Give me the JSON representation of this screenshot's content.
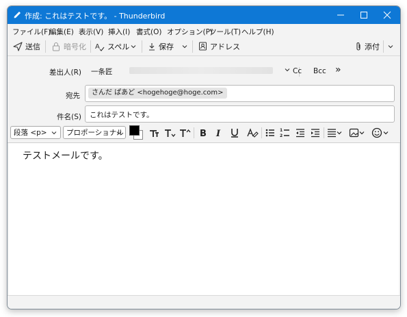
{
  "window": {
    "title": "作成: これはテストです。 - Thunderbird",
    "controls": [
      "minimize",
      "maximize",
      "close"
    ]
  },
  "menu": [
    "ファイル(F)",
    "編集(E)",
    "表示(V)",
    "挿入(I)",
    "書式(O)",
    "オプション(P)",
    "ツール(T)",
    "ヘルプ(H)"
  ],
  "toolbar": {
    "send": "送信",
    "encrypt": "暗号化",
    "spell": "スペル",
    "save": "保存",
    "address": "アドレス",
    "attach": "添付"
  },
  "header": {
    "from_label": "差出人(R)",
    "from_value": "一条匠",
    "cc": "Cc",
    "bcc": "Bcc",
    "more": "»",
    "to_label": "宛先",
    "to_recipient": "さんだ ぱあど <hogehoge@hoge.com>",
    "subject_label": "件名(S)",
    "subject_value": "これはテストです。"
  },
  "format": {
    "paragraph": "段落 <p>",
    "font": "プロポーショナル",
    "text_color": "#000000",
    "bg_color": "#ffffff"
  },
  "body": {
    "text": "テストメールです。"
  },
  "colors": {
    "titlebar": "#0e78d6",
    "chrome": "#f3f3f3"
  }
}
